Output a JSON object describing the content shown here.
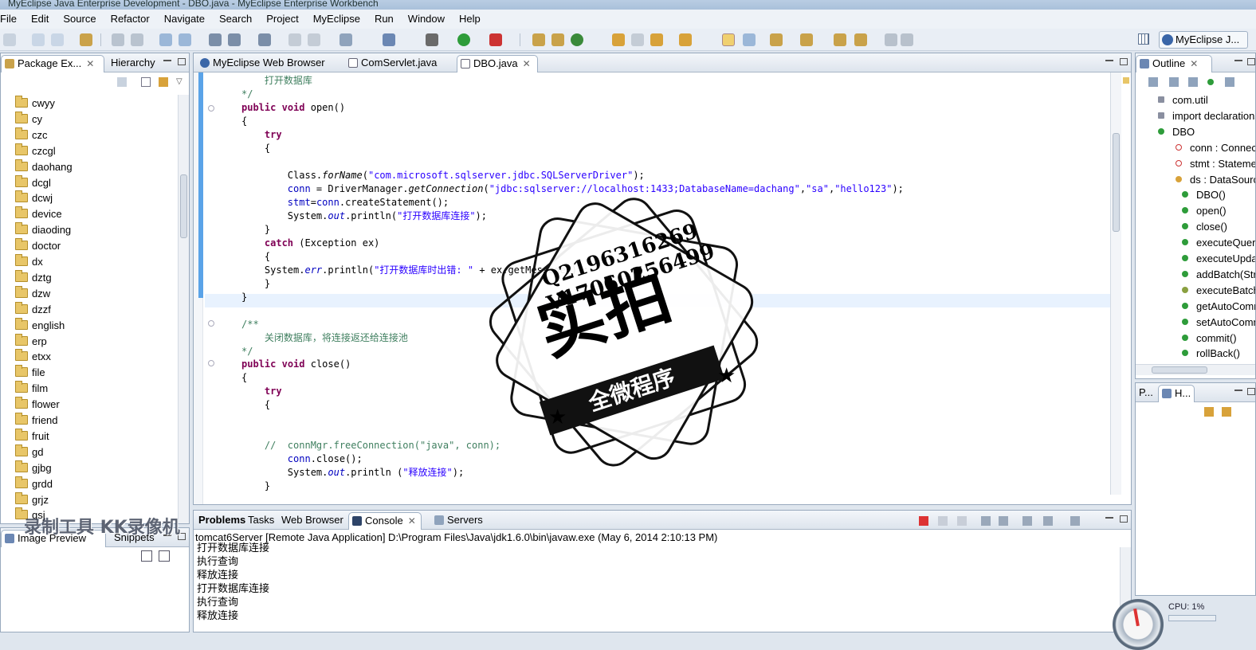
{
  "window": {
    "title": "MyEclipse Java Enterprise Development - DBO.java - MyEclipse Enterprise Workbench"
  },
  "menu": [
    "File",
    "Edit",
    "Source",
    "Refactor",
    "Navigate",
    "Search",
    "Project",
    "MyEclipse",
    "Run",
    "Window",
    "Help"
  ],
  "perspective": {
    "label": "MyEclipse J..."
  },
  "left_panel": {
    "tabs": [
      {
        "label": "Package Ex...",
        "close": "✕"
      },
      {
        "label": "Hierarchy"
      }
    ],
    "packages": [
      "cwyy",
      "cy",
      "czc",
      "czcgl",
      "daohang",
      "dcgl",
      "dcwj",
      "device",
      "diaoding",
      "doctor",
      "dx",
      "dztg",
      "dzw",
      "dzzf",
      "english",
      "erp",
      "etxx",
      "file",
      "film",
      "flower",
      "friend",
      "fruit",
      "gd",
      "gjbg",
      "grdd",
      "grjz",
      "gsj"
    ]
  },
  "left_bottom_panel": {
    "tabs": [
      {
        "label": "Image Preview"
      },
      {
        "label": "Snippets"
      }
    ]
  },
  "editor": {
    "tabs": [
      {
        "label": "MyEclipse Web Browser",
        "icon": "globe-icon"
      },
      {
        "label": "ComServlet.java",
        "icon": "java-file-icon"
      },
      {
        "label": "DBO.java",
        "icon": "java-file-icon",
        "close": "✕"
      }
    ]
  },
  "outline": {
    "title": "Outline",
    "close": "✕",
    "items": [
      "com.util",
      "import declarations",
      "DBO",
      "conn : Connection",
      "stmt : Statement",
      "ds : DataSource",
      "DBO()",
      "open()",
      "close()",
      "executeQuery",
      "executeUpdate",
      "addBatch(String)",
      "executeBatch()",
      "getAutoCommit()",
      "setAutoCommit",
      "commit()",
      "rollBack()"
    ]
  },
  "right_bottom_panel": {
    "tabs": [
      {
        "label": "P..."
      },
      {
        "label": "H..."
      }
    ]
  },
  "bottom_panel": {
    "tabs": [
      "Problems",
      "Tasks",
      "Web Browser",
      "Console",
      "Servers"
    ],
    "console_header": "tomcat6Server [Remote Java Application] D:\\Program Files\\Java\\jdk1.6.0\\bin\\javaw.exe (May 6, 2014 2:10:13 PM)",
    "lines": [
      "打开数据库连接",
      "执行查询",
      "释放连接",
      "打开数据库连接",
      "执行查询",
      "释放连接"
    ]
  },
  "watermark": {
    "qq": "Q2196316269",
    "vx": "V17060256499",
    "big": "实拍",
    "ribbon": "全微程序",
    "kk": "录制工具 KK录像机"
  },
  "cpu": {
    "label": "CPU: 1%"
  },
  "colors": {
    "keyword": "#7f0055",
    "string": "#2a00ff",
    "field": "#0000c0",
    "comment": "#3f7f5f",
    "selection_bar": "#5aa3e8"
  }
}
